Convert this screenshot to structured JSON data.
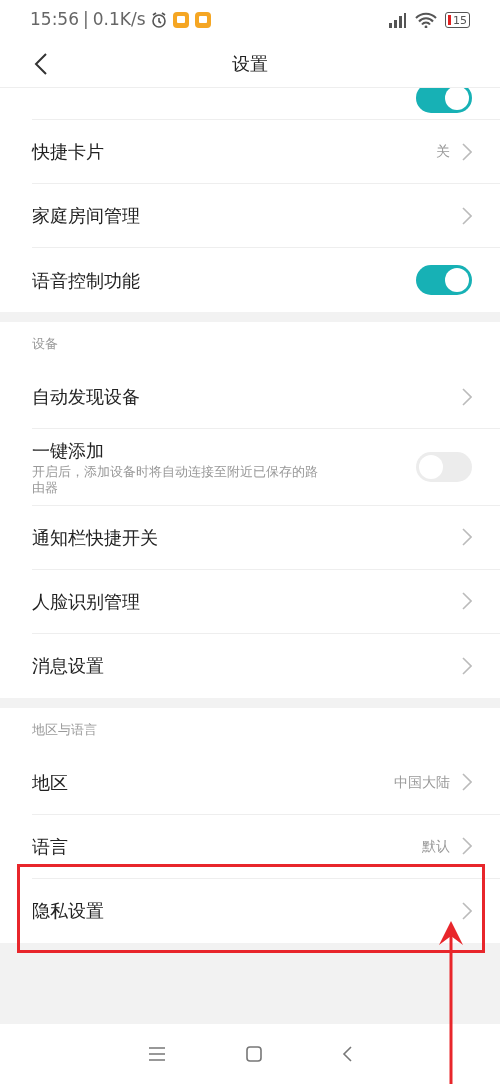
{
  "status_bar": {
    "time": "15:56",
    "separator": "|",
    "speed": "0.1K/s",
    "battery": "15"
  },
  "header": {
    "title": "设置"
  },
  "sections": [
    {
      "rows": [
        {
          "kind": "partial",
          "on": true
        },
        {
          "kind": "link",
          "label": "快捷卡片",
          "value": "关"
        },
        {
          "kind": "link",
          "label": "家庭房间管理"
        },
        {
          "kind": "toggle",
          "label": "语音控制功能",
          "on": true
        }
      ]
    },
    {
      "title": "设备",
      "rows": [
        {
          "kind": "link",
          "label": "自动发现设备"
        },
        {
          "kind": "toggle",
          "label": "一键添加",
          "description": "开启后，添加设备时将自动连接至附近已保存的路由器",
          "on": false
        },
        {
          "kind": "link",
          "label": "通知栏快捷开关"
        },
        {
          "kind": "link",
          "label": "人脸识别管理"
        },
        {
          "kind": "link",
          "label": "消息设置"
        }
      ]
    },
    {
      "title": "地区与语言",
      "rows": [
        {
          "kind": "link",
          "label": "地区",
          "value": "中国大陆"
        },
        {
          "kind": "link",
          "label": "语言",
          "value": "默认"
        },
        {
          "kind": "link",
          "label": "隐私设置",
          "highlighted": true
        }
      ]
    }
  ]
}
